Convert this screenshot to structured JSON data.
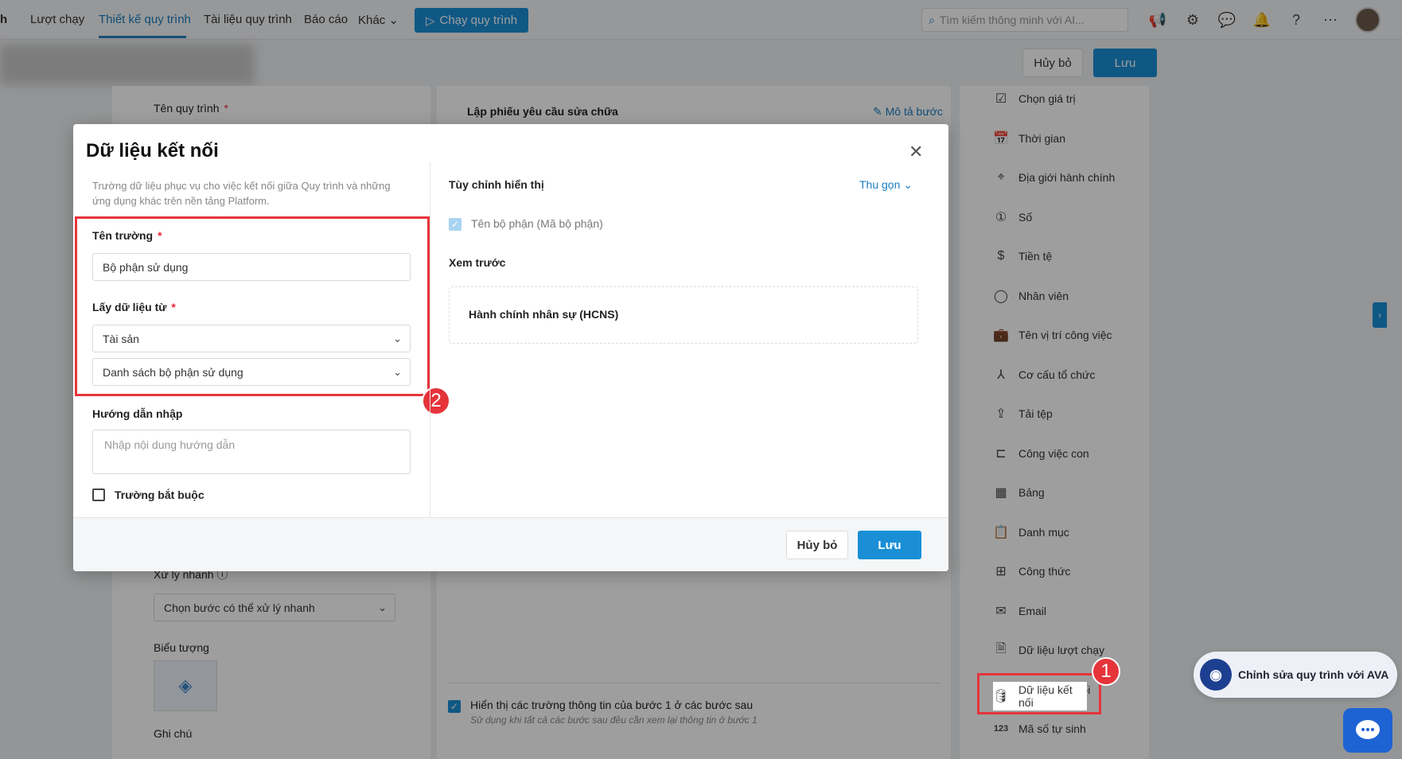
{
  "topbar": {
    "brand_fragment": "h",
    "nav": [
      "Lượt chạy",
      "Thiết kế quy trình",
      "Tài liệu quy trình",
      "Báo cáo",
      "Khác"
    ],
    "run_button": "Chạy quy trình",
    "search_placeholder": "Tìm kiếm thông minh với AI..."
  },
  "header": {
    "cancel": "Hủy bỏ",
    "save": "Lưu"
  },
  "left_panel": {
    "process_name_label": "Tên quy trình",
    "quick_process_label": "Xử lý nhanh",
    "quick_process_select": "Chọn bước có thể xử lý nhanh",
    "icon_label": "Biểu tượng",
    "note_label": "Ghi chú"
  },
  "middle_panel": {
    "step_title": "Lập phiếu yêu cầu sửa chữa",
    "describe_step": "Mô tả bước",
    "show_fields_label": "Hiển thị các trường thông tin của bước 1 ở các bước sau",
    "show_fields_hint": "Sử dụng khi tất cả các bước sau đều cần xem lại thông tin ở bước 1"
  },
  "right_panel": {
    "items": [
      {
        "label": "Chọn giá trị",
        "icon": "checkbox-edit-icon"
      },
      {
        "label": "Thời gian",
        "icon": "calendar-icon"
      },
      {
        "label": "Địa giới hành chính",
        "icon": "location-pin-icon"
      },
      {
        "label": "Số",
        "icon": "number-icon"
      },
      {
        "label": "Tiền tệ",
        "icon": "dollar-icon"
      },
      {
        "label": "Nhân viên",
        "icon": "user-icon"
      },
      {
        "label": "Tên vị trí công việc",
        "icon": "briefcase-icon"
      },
      {
        "label": "Cơ cấu tổ chức",
        "icon": "org-chart-icon"
      },
      {
        "label": "Tải tệp",
        "icon": "upload-icon"
      },
      {
        "label": "Công việc con",
        "icon": "subtask-icon"
      },
      {
        "label": "Bảng",
        "icon": "table-icon"
      },
      {
        "label": "Danh mục",
        "icon": "clipboard-list-icon"
      },
      {
        "label": "Công thức",
        "icon": "formula-icon"
      },
      {
        "label": "Email",
        "icon": "mail-icon"
      },
      {
        "label": "Dữ liệu lượt chạy",
        "icon": "document-icon"
      },
      {
        "label": "Dữ liệu kết nối",
        "icon": "database-icon"
      },
      {
        "label": "Mã số tự sinh",
        "icon": "auto-number-icon"
      }
    ]
  },
  "modal": {
    "title": "Dữ liệu kết nối",
    "description": "Trường dữ liệu phục vụ cho việc kết nối giữa Quy trình và những ứng dụng khác trên nền tảng Platform.",
    "field_name_label": "Tên trường",
    "field_name_value": "Bộ phận sử dụng",
    "source_label": "Lấy dữ liệu từ",
    "source_app": "Tài sản",
    "source_list": "Danh sách bộ phận sử dụng",
    "guide_label": "Hướng dẫn nhập",
    "guide_placeholder": "Nhập nội dung hướng dẫn",
    "required_label": "Trường bắt buộc",
    "custom_display_label": "Tùy chỉnh hiển thị",
    "collapse_label": "Thu gọn",
    "display_option": "Tên bộ phận (Mã bộ phận)",
    "preview_label": "Xem trước",
    "preview_value": "Hành chính nhân sự (HCNS)",
    "cancel": "Hủy bỏ",
    "save": "Lưu"
  },
  "annotations": {
    "badge1": "1",
    "badge2": "2"
  },
  "ava": {
    "label": "Chỉnh sửa quy trình với AVA"
  },
  "colors": {
    "accent": "#1a8fd6",
    "highlight": "#e5343a"
  }
}
